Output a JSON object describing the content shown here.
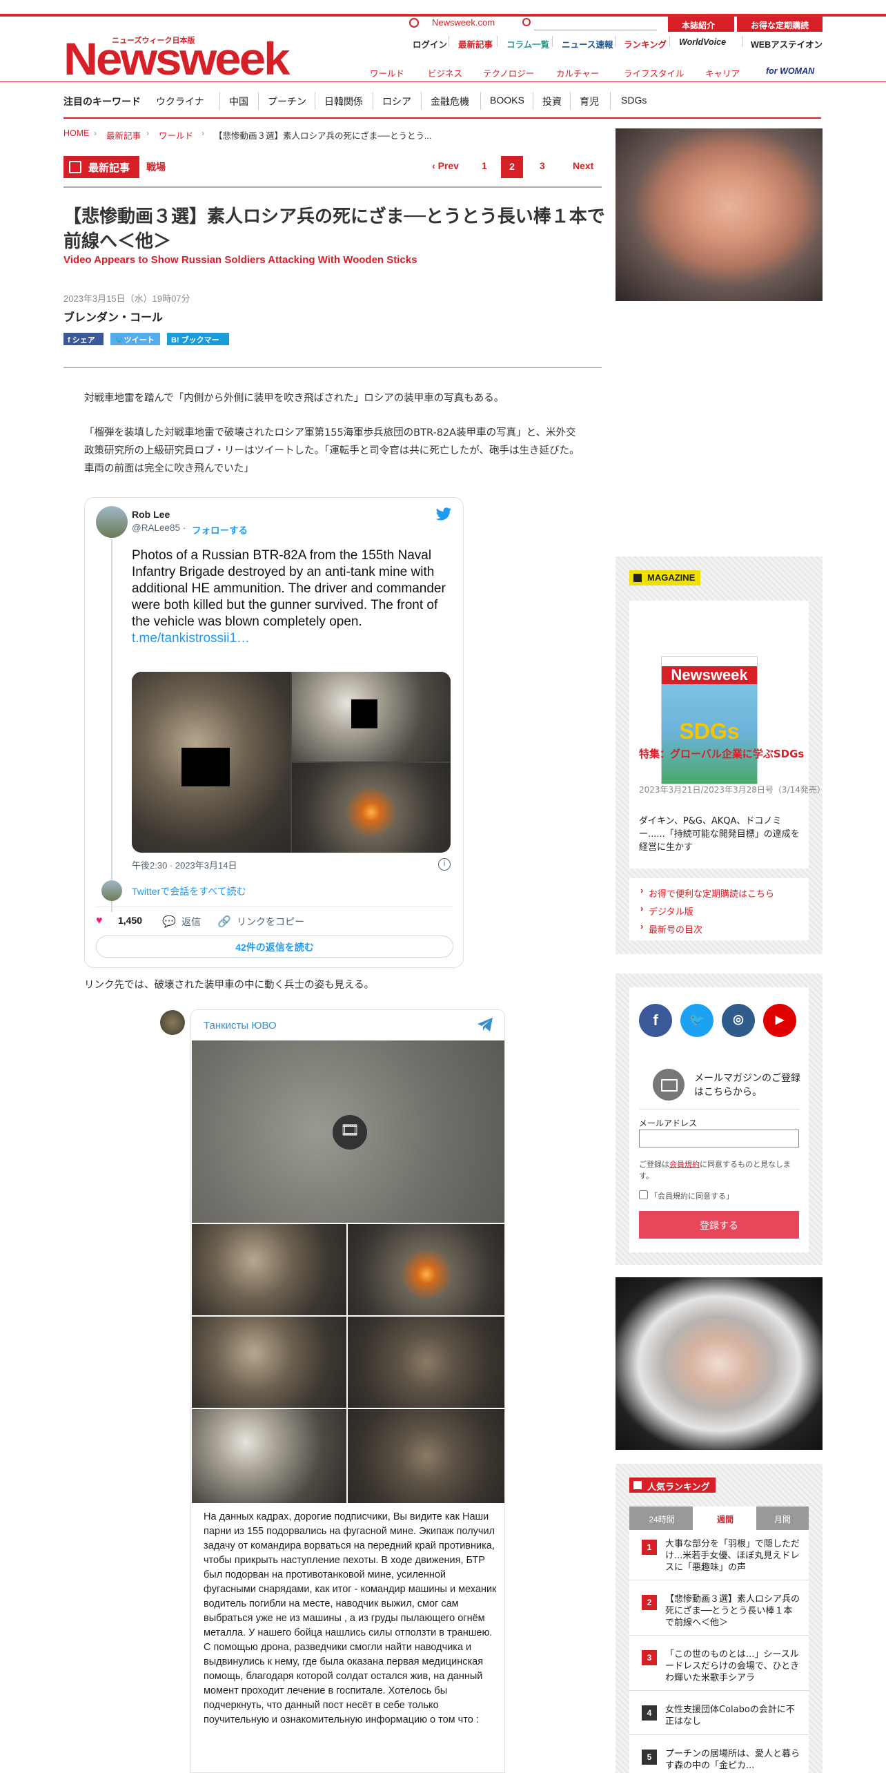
{
  "header": {
    "brand_small": "ニューズウィーク日本版",
    "brand_logo": "Newsweek",
    "site_link": "Newsweek.com",
    "buttons": [
      "本誌紹介",
      "お得な定期購読"
    ],
    "util_links": [
      "ログイン",
      "最新記事",
      "コラム一覧",
      "ニュース速報",
      "ランキング",
      "WorldVoice",
      "WEBアステイオン"
    ],
    "categories": [
      "ワールド",
      "ビジネス",
      "テクノロジー",
      "カルチャー",
      "ライフスタイル",
      "キャリア"
    ],
    "for_woman": "for WOMAN"
  },
  "keywords": [
    "注目のキーワード",
    "ウクライナ",
    "中国",
    "プーチン",
    "日韓関係",
    "ロシア",
    "金融危機",
    "BOOKS",
    "投資",
    "育児",
    "SDGs"
  ],
  "breadcrumb": [
    "HOME",
    "最新記事",
    "ワールド",
    "【悲惨動画３選】素人ロシア兵の死にざま──とうとう..."
  ],
  "article": {
    "tag_label": "最新記事",
    "tag_sub": "戦場",
    "pagination": {
      "prev": "Prev",
      "pages": [
        "1",
        "2",
        "3"
      ],
      "current": "2",
      "next": "Next"
    },
    "title": "【悲惨動画３選】素人ロシア兵の死にざま──とうとう長い棒１本で前線へ＜他＞",
    "subtitle": "Video Appears to Show Russian Soldiers Attacking With Wooden Sticks",
    "date": "2023年3月15日（水）19時07分",
    "author": "ブレンダン・コール",
    "share": [
      "シェア",
      "ツイート",
      "ブックマーク"
    ],
    "para1": "対戦車地雷を踏んで「内側から外側に装甲を吹き飛ばされた」ロシアの装甲車の写真もある。",
    "para2": "「榴弾を装填した対戦車地雷で破壊されたロシア軍第155海軍歩兵旅団のBTR-82A装甲車の写真」と、米外交政策研究所の上級研究員ロブ・リーはツイートした。「運転手と司令官は共に死亡したが、砲手は生き延びた。車両の前面は完全に吹き飛んでいた」",
    "para3": "リンク先では、破壊された装甲車の中に動く兵士の姿も見える。"
  },
  "tweet": {
    "name": "Rob Lee",
    "handle": "@RALee85 ·",
    "follow": "フォローする",
    "text": "Photos of a Russian BTR-82A from the 155th Naval Infantry Brigade destroyed by an anti-tank mine with additional HE ammunition. The driver and commander were both killed but the gunner survived. The front of the vehicle was blown completely open.",
    "link": "t.me/tankistrossii1…",
    "time": "午後2:30 · 2023年3月14日",
    "conversation": "Twitterで会話をすべて読む",
    "likes": "1,450",
    "reply": "返信",
    "copy_link": "リンクをコピー",
    "read_replies": "42件の返信を読む"
  },
  "telegram": {
    "channel": "Танкисты ЮВО",
    "text": "На данных кадрах, дорогие подписчики, Вы видите как Наши парни из 155 подорвались на фугасной мине. Экипаж получил задачу от командира ворваться на передний край противника, чтобы прикрыть наступление пехоты. В ходе движения, БТР был подорван на противотанковой мине, усиленной фугасными снарядами, как итог - командир машины и механик водитель погибли на месте, наводчик выжил, смог сам выбраться уже не из машины , а из груды пылающего огнём металла. У нашего бойца нашлись силы отползти в траншею. С помощью дрона, разведчики смогли найти наводчика и выдвинулись к нему, где была оказана первая медицинская помощь, благодаря которой солдат остался жив, на данный момент проходит лечение в госпитале. Хотелось бы подчеркнуть, что данный пост несёт в себе только поучительную и ознакомительную информацию о том что :"
  },
  "magazine": {
    "label": "MAGAZINE",
    "cover_logo": "Newsweek",
    "cover_headline": "SDGs",
    "title": "特集：グローバル企業に学ぶSDGs",
    "date": "2023年3月21日/2023年3月28日号（3/14発売）",
    "desc": "ダイキン、P&G、AKQA、ドコノミー......「持続可能な開発目標」の達成を経営に生かす",
    "links": [
      "お得で便利な定期購読はこちら",
      "デジタル版",
      "最新号の目次"
    ]
  },
  "newsletter": {
    "heading": "メールマガジンのご登録はこちらから。",
    "email_label": "メールアドレス",
    "email_value": "",
    "terms_pre": "ご登録は",
    "terms_link": "会員規約",
    "terms_post": "に同意するものと見なします。",
    "agree": "「会員規約に同意する」",
    "submit": "登録する"
  },
  "ranking": {
    "label": "人気ランキング",
    "tabs": [
      "24時間",
      "週間",
      "月間"
    ],
    "active_tab": "週間",
    "items": [
      {
        "rank": "1",
        "text": "大事な部分を「羽根」で隠しただけ...米若手女優、ほぼ丸見えドレスに「悪趣味」の声"
      },
      {
        "rank": "2",
        "text": "【悲惨動画３選】素人ロシア兵の死にざま──とうとう長い棒１本で前線へ＜他＞"
      },
      {
        "rank": "3",
        "text": "「この世のものとは...」シースルードレスだらけの会場で、ひときわ輝いた米歌手シアラ"
      },
      {
        "rank": "4",
        "text": "女性支援団体Colaboの会計に不正はなし"
      },
      {
        "rank": "5",
        "text": "プーチンの居場所は、愛人と暮らす森の中の「金ピカ..."
      }
    ]
  },
  "colors": {
    "accent": "#d61f26",
    "twitter": "#1d9bf0",
    "telegram": "#3a8fc7"
  }
}
